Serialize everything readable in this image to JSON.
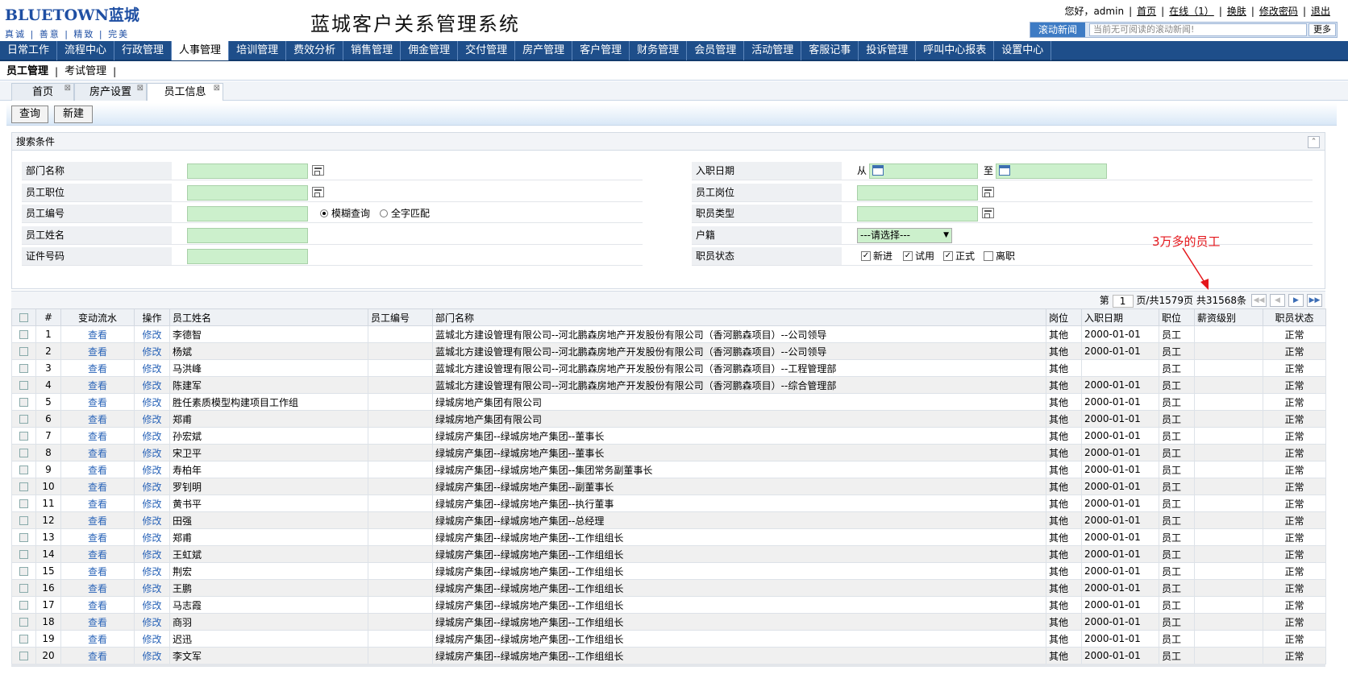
{
  "header": {
    "logo_brand": "BLUETOWN蓝城",
    "logo_slogan": "真诚 | 善意 | 精致 | 完美",
    "system_title": "蓝城客户关系管理系统",
    "greeting": "您好，admin",
    "links": [
      "首页",
      "在线（1）",
      "换肤",
      "修改密码",
      "退出"
    ],
    "news_label": "滚动新闻",
    "news_text": "当前无可阅读的滚动新闻!",
    "news_more": "更多"
  },
  "main_nav": [
    "日常工作",
    "流程中心",
    "行政管理",
    "人事管理",
    "培训管理",
    "费效分析",
    "销售管理",
    "佣金管理",
    "交付管理",
    "房产管理",
    "客户管理",
    "财务管理",
    "会员管理",
    "活动管理",
    "客服记事",
    "投诉管理",
    "呼叫中心报表",
    "设置中心"
  ],
  "main_nav_active": "人事管理",
  "sub_nav": [
    "员工管理",
    "考试管理"
  ],
  "page_tabs": [
    "首页",
    "房产设置",
    "员工信息"
  ],
  "toolbar": {
    "query": "查询",
    "new": "新建"
  },
  "search": {
    "title": "搜索条件",
    "dept_label": "部门名称",
    "position_label": "员工职位",
    "empno_label": "员工编号",
    "fuzzy": "模糊查询",
    "exact": "全字匹配",
    "name_label": "员工姓名",
    "idno_label": "证件号码",
    "hire_label": "入职日期",
    "from": "从",
    "to": "至",
    "post_label": "员工岗位",
    "type_label": "职员类型",
    "hukou_label": "户籍",
    "hukou_value": "---请选择---",
    "status_label": "职员状态",
    "status_options": [
      "新进",
      "试用",
      "正式",
      "离职"
    ],
    "status_checked": [
      true,
      true,
      true,
      false
    ]
  },
  "annotation": "3万多的员工",
  "pager": {
    "prefix": "第",
    "page": "1",
    "suffix": "页/共1579页 共31568条"
  },
  "table": {
    "columns": [
      "#",
      "变动流水",
      "操作",
      "员工姓名",
      "员工编号",
      "部门名称",
      "岗位",
      "入职日期",
      "职位",
      "薪资级别",
      "职员状态"
    ],
    "view_label": "查看",
    "edit_label": "修改",
    "rows": [
      {
        "no": "1",
        "name": "李德智",
        "empno": "",
        "dept": "蓝城北方建设管理有限公司--河北鹏森房地产开发股份有限公司（香河鹏森项目）--公司领导",
        "post": "其他",
        "date": "2000-01-01",
        "position": "员工",
        "grade": "",
        "status": "正常"
      },
      {
        "no": "2",
        "name": "杨斌",
        "empno": "",
        "dept": "蓝城北方建设管理有限公司--河北鹏森房地产开发股份有限公司（香河鹏森项目）--公司领导",
        "post": "其他",
        "date": "2000-01-01",
        "position": "员工",
        "grade": "",
        "status": "正常"
      },
      {
        "no": "3",
        "name": "马洪峰",
        "empno": "",
        "dept": "蓝城北方建设管理有限公司--河北鹏森房地产开发股份有限公司（香河鹏森项目）--工程管理部",
        "post": "其他",
        "date": "",
        "position": "员工",
        "grade": "",
        "status": "正常"
      },
      {
        "no": "4",
        "name": "陈建军",
        "empno": "",
        "dept": "蓝城北方建设管理有限公司--河北鹏森房地产开发股份有限公司（香河鹏森项目）--综合管理部",
        "post": "其他",
        "date": "2000-01-01",
        "position": "员工",
        "grade": "",
        "status": "正常"
      },
      {
        "no": "5",
        "name": "胜任素质模型构建项目工作组",
        "empno": "",
        "dept": "绿城房地产集团有限公司",
        "post": "其他",
        "date": "2000-01-01",
        "position": "员工",
        "grade": "",
        "status": "正常"
      },
      {
        "no": "6",
        "name": "郑甫",
        "empno": "",
        "dept": "绿城房地产集团有限公司",
        "post": "其他",
        "date": "2000-01-01",
        "position": "员工",
        "grade": "",
        "status": "正常"
      },
      {
        "no": "7",
        "name": "孙宏斌",
        "empno": "",
        "dept": "绿城房产集团--绿城房地产集团--董事长",
        "post": "其他",
        "date": "2000-01-01",
        "position": "员工",
        "grade": "",
        "status": "正常"
      },
      {
        "no": "8",
        "name": "宋卫平",
        "empno": "",
        "dept": "绿城房产集团--绿城房地产集团--董事长",
        "post": "其他",
        "date": "2000-01-01",
        "position": "员工",
        "grade": "",
        "status": "正常"
      },
      {
        "no": "9",
        "name": "寿柏年",
        "empno": "",
        "dept": "绿城房产集团--绿城房地产集团--集团常务副董事长",
        "post": "其他",
        "date": "2000-01-01",
        "position": "员工",
        "grade": "",
        "status": "正常"
      },
      {
        "no": "10",
        "name": "罗钊明",
        "empno": "",
        "dept": "绿城房产集团--绿城房地产集团--副董事长",
        "post": "其他",
        "date": "2000-01-01",
        "position": "员工",
        "grade": "",
        "status": "正常"
      },
      {
        "no": "11",
        "name": "黄书平",
        "empno": "",
        "dept": "绿城房产集团--绿城房地产集团--执行董事",
        "post": "其他",
        "date": "2000-01-01",
        "position": "员工",
        "grade": "",
        "status": "正常"
      },
      {
        "no": "12",
        "name": "田强",
        "empno": "",
        "dept": "绿城房产集团--绿城房地产集团--总经理",
        "post": "其他",
        "date": "2000-01-01",
        "position": "员工",
        "grade": "",
        "status": "正常"
      },
      {
        "no": "13",
        "name": "郑甫",
        "empno": "",
        "dept": "绿城房产集团--绿城房地产集团--工作组组长",
        "post": "其他",
        "date": "2000-01-01",
        "position": "员工",
        "grade": "",
        "status": "正常"
      },
      {
        "no": "14",
        "name": "王虹斌",
        "empno": "",
        "dept": "绿城房产集团--绿城房地产集团--工作组组长",
        "post": "其他",
        "date": "2000-01-01",
        "position": "员工",
        "grade": "",
        "status": "正常"
      },
      {
        "no": "15",
        "name": "荆宏",
        "empno": "",
        "dept": "绿城房产集团--绿城房地产集团--工作组组长",
        "post": "其他",
        "date": "2000-01-01",
        "position": "员工",
        "grade": "",
        "status": "正常"
      },
      {
        "no": "16",
        "name": "王鹏",
        "empno": "",
        "dept": "绿城房产集团--绿城房地产集团--工作组组长",
        "post": "其他",
        "date": "2000-01-01",
        "position": "员工",
        "grade": "",
        "status": "正常"
      },
      {
        "no": "17",
        "name": "马志霞",
        "empno": "",
        "dept": "绿城房产集团--绿城房地产集团--工作组组长",
        "post": "其他",
        "date": "2000-01-01",
        "position": "员工",
        "grade": "",
        "status": "正常"
      },
      {
        "no": "18",
        "name": "商羽",
        "empno": "",
        "dept": "绿城房产集团--绿城房地产集团--工作组组长",
        "post": "其他",
        "date": "2000-01-01",
        "position": "员工",
        "grade": "",
        "status": "正常"
      },
      {
        "no": "19",
        "name": "迟迅",
        "empno": "",
        "dept": "绿城房产集团--绿城房地产集团--工作组组长",
        "post": "其他",
        "date": "2000-01-01",
        "position": "员工",
        "grade": "",
        "status": "正常"
      },
      {
        "no": "20",
        "name": "李文军",
        "empno": "",
        "dept": "绿城房产集团--绿城房地产集团--工作组组长",
        "post": "其他",
        "date": "2000-01-01",
        "position": "员工",
        "grade": "",
        "status": "正常"
      }
    ]
  },
  "colors": {
    "nav_bg": "#1e4e8a",
    "input_bg": "#ccf0cc",
    "link": "#2a64b8",
    "annotation": "#e4161b"
  }
}
